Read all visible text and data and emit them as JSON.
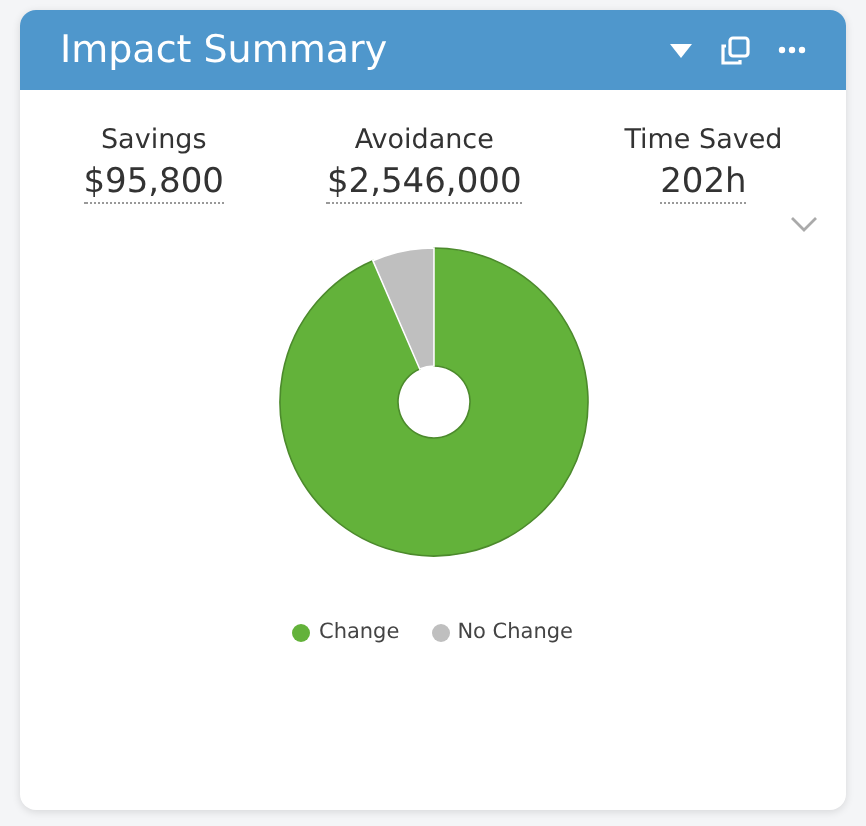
{
  "card": {
    "title": "Impact Summary"
  },
  "stats": [
    {
      "label": "Savings",
      "value": "$95,800"
    },
    {
      "label": "Avoidance",
      "value": "$2,546,000"
    },
    {
      "label": "Time Saved",
      "value": "202h"
    }
  ],
  "legend": [
    {
      "label": "Change",
      "color": "#63b23a"
    },
    {
      "label": "No Change",
      "color": "#bfbfbf"
    }
  ]
}
